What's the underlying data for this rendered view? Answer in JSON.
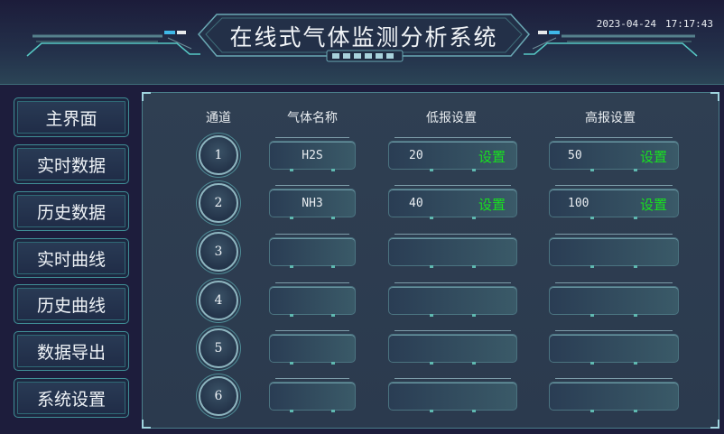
{
  "header": {
    "title": "在线式气体监测分析系统",
    "date": "2023-04-24",
    "time": "17:17:43"
  },
  "nav": {
    "items": [
      {
        "label": "主界面"
      },
      {
        "label": "实时数据"
      },
      {
        "label": "历史数据"
      },
      {
        "label": "实时曲线"
      },
      {
        "label": "历史曲线"
      },
      {
        "label": "数据导出"
      },
      {
        "label": "系统设置"
      }
    ]
  },
  "table": {
    "headers": {
      "channel": "通道",
      "gas_name": "气体名称",
      "low_alarm": "低报设置",
      "high_alarm": "高报设置"
    },
    "set_label": "设置",
    "rows": [
      {
        "channel": "1",
        "gas_name": "H2S",
        "low": "20",
        "high": "50"
      },
      {
        "channel": "2",
        "gas_name": "NH3",
        "low": "40",
        "high": "100"
      },
      {
        "channel": "3",
        "gas_name": "",
        "low": "",
        "high": ""
      },
      {
        "channel": "4",
        "gas_name": "",
        "low": "",
        "high": ""
      },
      {
        "channel": "5",
        "gas_name": "",
        "low": "",
        "high": ""
      },
      {
        "channel": "6",
        "gas_name": "",
        "low": "",
        "high": ""
      }
    ]
  },
  "colors": {
    "background": "#1d1d3c",
    "accent_teal": "#4f8c96",
    "set_green": "#18e020"
  }
}
